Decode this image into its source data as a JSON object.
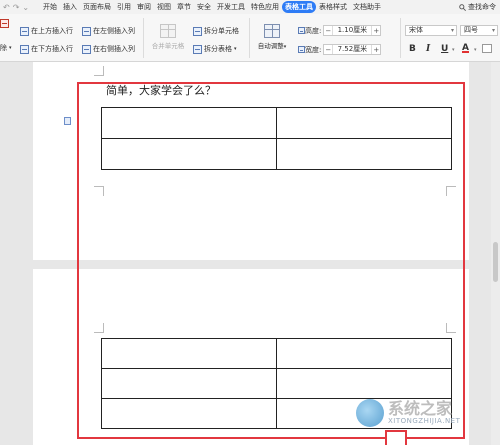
{
  "menu": {
    "quick_access": [
      "↶",
      "↷",
      "⌄"
    ],
    "tabs": [
      {
        "label": "开始",
        "active": false
      },
      {
        "label": "插入",
        "active": false
      },
      {
        "label": "页面布局",
        "active": false
      },
      {
        "label": "引用",
        "active": false
      },
      {
        "label": "审阅",
        "active": false
      },
      {
        "label": "视图",
        "active": false
      },
      {
        "label": "章节",
        "active": false
      },
      {
        "label": "安全",
        "active": false
      },
      {
        "label": "开发工具",
        "active": false
      },
      {
        "label": "特色应用",
        "active": false
      },
      {
        "label": "表格工具",
        "active": true
      },
      {
        "label": "表格样式",
        "active": false
      },
      {
        "label": "文档助手",
        "active": false
      }
    ],
    "search_label": "查找命令",
    "accent_color": "#2e7cf6"
  },
  "ribbon": {
    "delete_label": "除",
    "insert_above": "在上方插入行",
    "insert_below": "在下方插入行",
    "insert_left": "在左侧插入列",
    "insert_right": "在右侧插入列",
    "merge_cells": "合并单元格",
    "split_cells": "拆分单元格",
    "split_table": "拆分表格",
    "auto_fit": "自动调整",
    "height_label": "高度:",
    "height_value": "1.10厘米",
    "width_label": "宽度:",
    "width_value": "7.52厘米",
    "font_name": "宋体",
    "font_size": "四号",
    "bold": "B",
    "italic": "I",
    "underline": "U"
  },
  "document": {
    "body_text": "简单，大家学会了么？",
    "top_table": {
      "rows": 2,
      "cols": 2
    },
    "bottom_table": {
      "rows": 3,
      "cols": 2
    },
    "highlight_color": "#e2373f"
  },
  "watermark": {
    "text": "系统之家",
    "url": "XITONGZHIJIA.NET"
  }
}
